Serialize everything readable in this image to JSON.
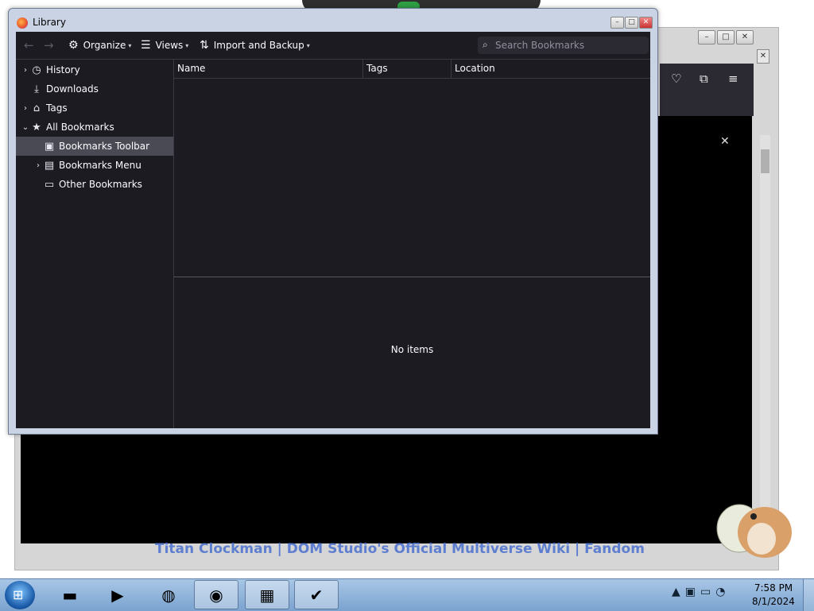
{
  "window": {
    "title": "Library",
    "buttons": {
      "minimize": "–",
      "maximize": "□",
      "close": "✕"
    }
  },
  "toolbar": {
    "back_icon": "←",
    "forward_icon": "→",
    "organize_label": "Organize",
    "views_label": "Views",
    "import_label": "Import and Backup",
    "search_placeholder": "Search Bookmarks"
  },
  "tree": {
    "items": [
      {
        "label": "History",
        "icon": "clock-icon",
        "expander": "›"
      },
      {
        "label": "Downloads",
        "icon": "download-icon",
        "expander": ""
      },
      {
        "label": "Tags",
        "icon": "tag-icon",
        "expander": "›"
      },
      {
        "label": "All Bookmarks",
        "icon": "star-icon",
        "expander": "⌄"
      },
      {
        "label": "Bookmarks Toolbar",
        "icon": "bookmarks-toolbar-icon",
        "expander": "",
        "selected": true
      },
      {
        "label": "Bookmarks Menu",
        "icon": "bookmarks-menu-icon",
        "expander": "›"
      },
      {
        "label": "Other Bookmarks",
        "icon": "folder-icon",
        "expander": ""
      }
    ]
  },
  "list": {
    "columns": [
      "Name",
      "Tags",
      "Location"
    ],
    "rows": []
  },
  "details": {
    "empty_text": "No items"
  },
  "background": {
    "page_title": "Titan Clockman | DOM Studio's Official Multiverse Wiki | Fandom"
  },
  "taskbar": {
    "time": "7:58 PM",
    "date": "8/1/2024"
  },
  "colors": {
    "library_bg": "#1c1b22",
    "library_selected": "#4a4a55",
    "text": "#fbfbfe",
    "taskbar": "#8fb3da"
  }
}
